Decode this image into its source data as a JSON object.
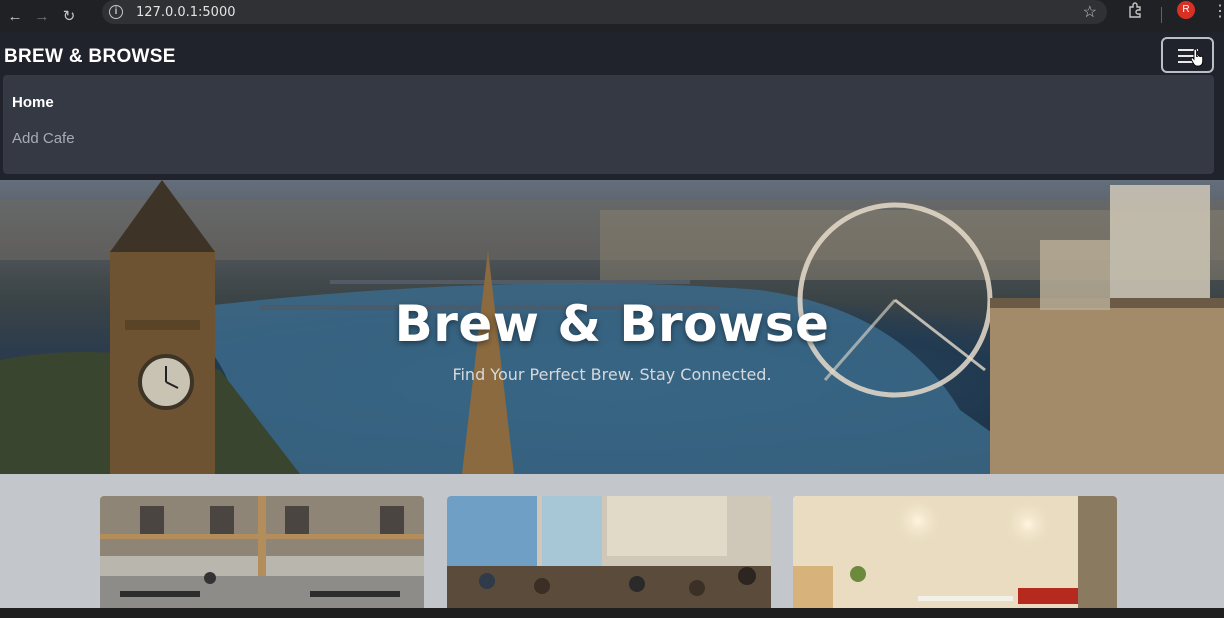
{
  "browser": {
    "url": "127.0.0.1:5000",
    "profile_initial": "R",
    "icons": [
      "back-arrow-icon",
      "forward-arrow-icon",
      "reload-icon",
      "site-info-icon",
      "bookmark-star-icon",
      "extensions-icon",
      "more-menu-icon"
    ]
  },
  "navbar": {
    "brand": "BREW & BROWSE",
    "menu": [
      {
        "label": "Home",
        "active": true
      },
      {
        "label": "Add Cafe",
        "active": false
      }
    ]
  },
  "hero": {
    "title": "Brew & Browse",
    "subtitle": "Find Your Perfect Brew. Stay Connected."
  },
  "cards": [
    {
      "image": "outdoor-courtyard-cafe"
    },
    {
      "image": "busy-indoor-cafe"
    },
    {
      "image": "warm-minimal-cafe-interior"
    }
  ],
  "colors": {
    "navbar_bg": "#20232b",
    "menu_bg": "#353944",
    "page_bg": "#c3c7cc"
  }
}
